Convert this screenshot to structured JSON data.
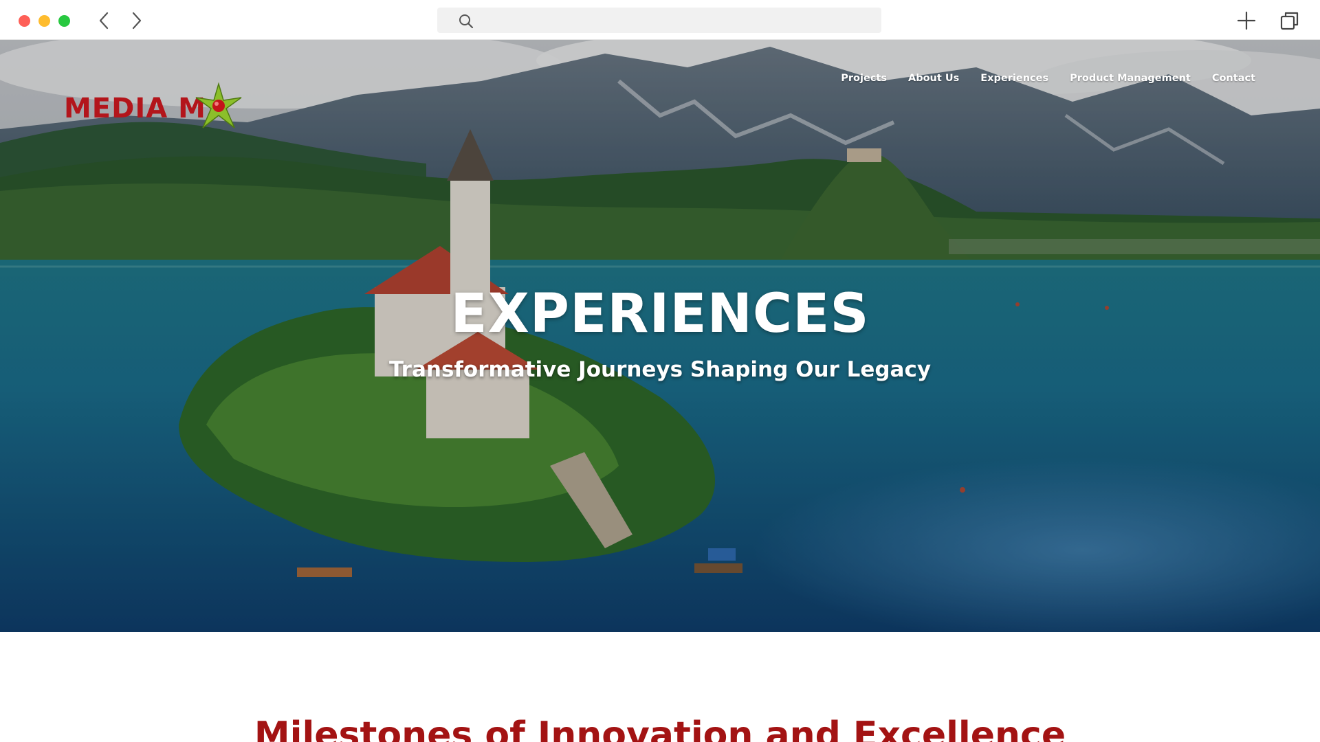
{
  "browser": {
    "address_placeholder": "",
    "icons": {
      "back": "chevron-left-icon",
      "forward": "chevron-right-icon",
      "search": "search-icon",
      "new_tab": "plus-icon",
      "tabs": "tabs-icon"
    },
    "traffic_lights": [
      "#fe5f57",
      "#febc2e",
      "#28c840"
    ]
  },
  "site": {
    "logo_text": "MEDIA M",
    "brand_color": "#b3151b",
    "nav": [
      {
        "label": "Projects"
      },
      {
        "label": "About Us"
      },
      {
        "label": "Experiences"
      },
      {
        "label": "Product Management"
      },
      {
        "label": "Contact"
      }
    ]
  },
  "hero": {
    "title": "EXPERIENCES",
    "subtitle": "Transformative Journeys Shaping Our Legacy"
  },
  "section": {
    "title": "Milestones of Innovation and Excellence",
    "title_color": "#a31313"
  }
}
